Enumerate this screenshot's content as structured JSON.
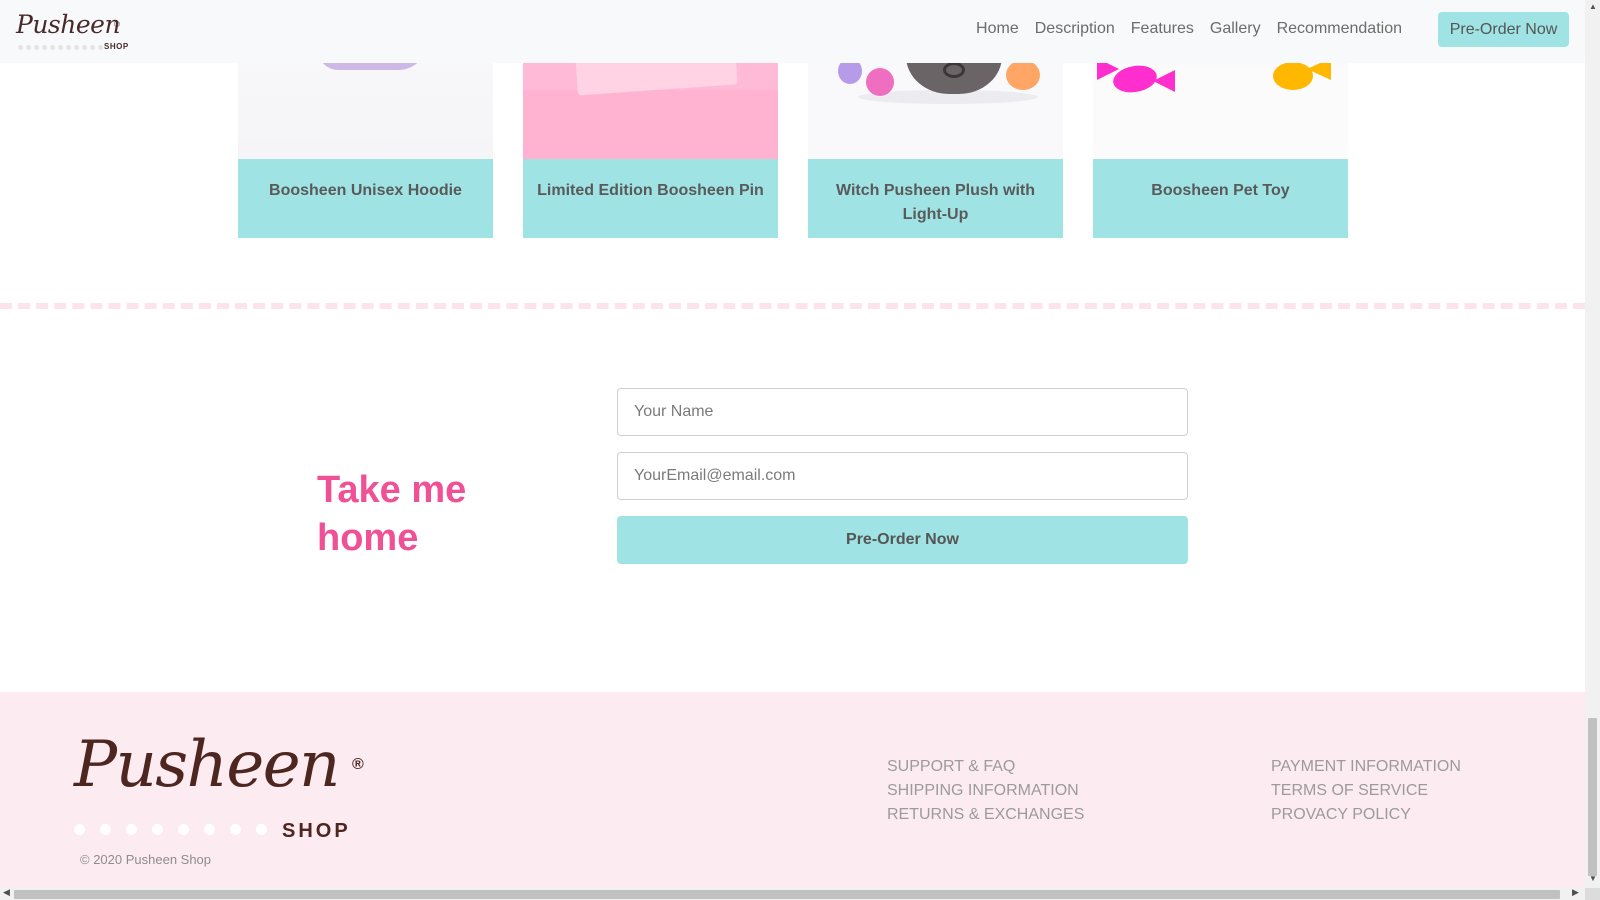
{
  "header": {
    "brand": {
      "word": "Pusheen",
      "reg": "®",
      "shop": "SHOP"
    },
    "nav": [
      "Home",
      "Description",
      "Features",
      "Gallery",
      "Recommendation"
    ],
    "cta": "Pre-Order Now"
  },
  "products": [
    {
      "name": "Boosheen Unisex Hoodie"
    },
    {
      "name": "Limited Edition Boosheen Pin"
    },
    {
      "name": "Witch Pusheen Plush with Light-Up"
    },
    {
      "name": "Boosheen Pet Toy"
    }
  ],
  "signup": {
    "title": "Take me home",
    "name_placeholder": "Your Name",
    "email_placeholder": "YourEmail@email.com",
    "submit_label": "Pre-Order Now"
  },
  "footer": {
    "logo": {
      "word": "Pusheen",
      "reg": "®",
      "shop": "SHOP"
    },
    "copyright": "© 2020 Pusheen Shop",
    "col1": [
      "SUPPORT & FAQ",
      "SHIPPING INFORMATION",
      "RETURNS & EXCHANGES"
    ],
    "col2": [
      "PAYMENT INFORMATION",
      "TERMS OF SERVICE",
      "PROVACY POLICY"
    ]
  },
  "colors": {
    "accent": "#9fe3e4",
    "title_pink": "#ef5096",
    "footer_bg": "#fdebf2",
    "brand_brown": "#4d2620"
  },
  "icons": [
    "scroll-up-arrow-icon",
    "scroll-down-arrow-icon",
    "scroll-left-arrow-icon",
    "scroll-right-arrow-icon"
  ]
}
